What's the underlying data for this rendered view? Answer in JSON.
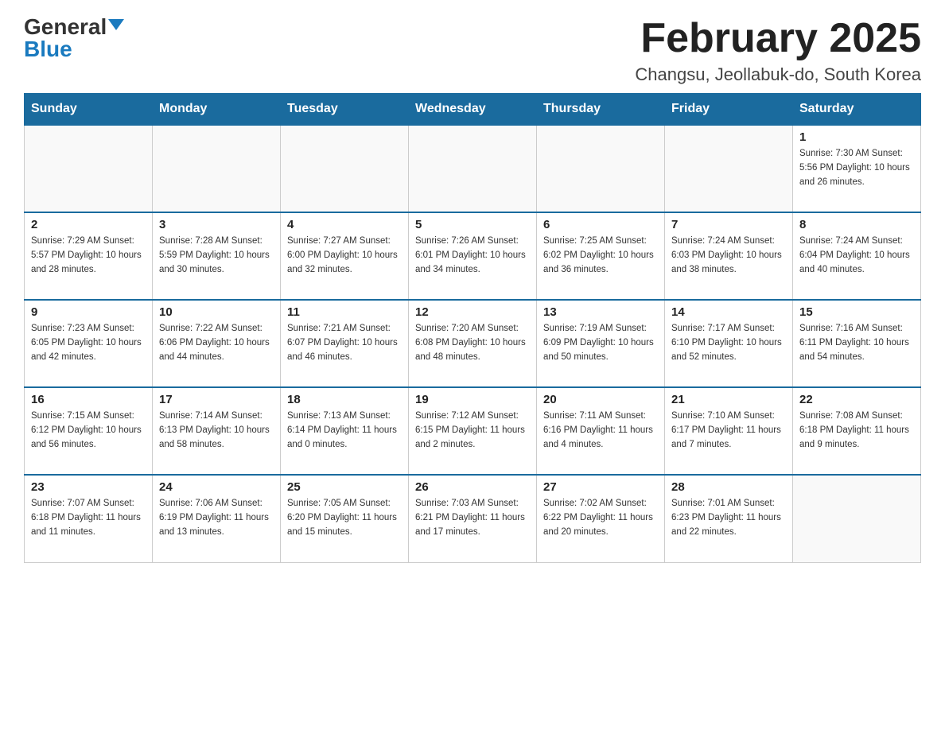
{
  "header": {
    "logo_general": "General",
    "logo_blue": "Blue",
    "month_title": "February 2025",
    "location": "Changsu, Jeollabuk-do, South Korea"
  },
  "days_of_week": [
    "Sunday",
    "Monday",
    "Tuesday",
    "Wednesday",
    "Thursday",
    "Friday",
    "Saturday"
  ],
  "weeks": [
    [
      {
        "day": "",
        "info": ""
      },
      {
        "day": "",
        "info": ""
      },
      {
        "day": "",
        "info": ""
      },
      {
        "day": "",
        "info": ""
      },
      {
        "day": "",
        "info": ""
      },
      {
        "day": "",
        "info": ""
      },
      {
        "day": "1",
        "info": "Sunrise: 7:30 AM\nSunset: 5:56 PM\nDaylight: 10 hours\nand 26 minutes."
      }
    ],
    [
      {
        "day": "2",
        "info": "Sunrise: 7:29 AM\nSunset: 5:57 PM\nDaylight: 10 hours\nand 28 minutes."
      },
      {
        "day": "3",
        "info": "Sunrise: 7:28 AM\nSunset: 5:59 PM\nDaylight: 10 hours\nand 30 minutes."
      },
      {
        "day": "4",
        "info": "Sunrise: 7:27 AM\nSunset: 6:00 PM\nDaylight: 10 hours\nand 32 minutes."
      },
      {
        "day": "5",
        "info": "Sunrise: 7:26 AM\nSunset: 6:01 PM\nDaylight: 10 hours\nand 34 minutes."
      },
      {
        "day": "6",
        "info": "Sunrise: 7:25 AM\nSunset: 6:02 PM\nDaylight: 10 hours\nand 36 minutes."
      },
      {
        "day": "7",
        "info": "Sunrise: 7:24 AM\nSunset: 6:03 PM\nDaylight: 10 hours\nand 38 minutes."
      },
      {
        "day": "8",
        "info": "Sunrise: 7:24 AM\nSunset: 6:04 PM\nDaylight: 10 hours\nand 40 minutes."
      }
    ],
    [
      {
        "day": "9",
        "info": "Sunrise: 7:23 AM\nSunset: 6:05 PM\nDaylight: 10 hours\nand 42 minutes."
      },
      {
        "day": "10",
        "info": "Sunrise: 7:22 AM\nSunset: 6:06 PM\nDaylight: 10 hours\nand 44 minutes."
      },
      {
        "day": "11",
        "info": "Sunrise: 7:21 AM\nSunset: 6:07 PM\nDaylight: 10 hours\nand 46 minutes."
      },
      {
        "day": "12",
        "info": "Sunrise: 7:20 AM\nSunset: 6:08 PM\nDaylight: 10 hours\nand 48 minutes."
      },
      {
        "day": "13",
        "info": "Sunrise: 7:19 AM\nSunset: 6:09 PM\nDaylight: 10 hours\nand 50 minutes."
      },
      {
        "day": "14",
        "info": "Sunrise: 7:17 AM\nSunset: 6:10 PM\nDaylight: 10 hours\nand 52 minutes."
      },
      {
        "day": "15",
        "info": "Sunrise: 7:16 AM\nSunset: 6:11 PM\nDaylight: 10 hours\nand 54 minutes."
      }
    ],
    [
      {
        "day": "16",
        "info": "Sunrise: 7:15 AM\nSunset: 6:12 PM\nDaylight: 10 hours\nand 56 minutes."
      },
      {
        "day": "17",
        "info": "Sunrise: 7:14 AM\nSunset: 6:13 PM\nDaylight: 10 hours\nand 58 minutes."
      },
      {
        "day": "18",
        "info": "Sunrise: 7:13 AM\nSunset: 6:14 PM\nDaylight: 11 hours\nand 0 minutes."
      },
      {
        "day": "19",
        "info": "Sunrise: 7:12 AM\nSunset: 6:15 PM\nDaylight: 11 hours\nand 2 minutes."
      },
      {
        "day": "20",
        "info": "Sunrise: 7:11 AM\nSunset: 6:16 PM\nDaylight: 11 hours\nand 4 minutes."
      },
      {
        "day": "21",
        "info": "Sunrise: 7:10 AM\nSunset: 6:17 PM\nDaylight: 11 hours\nand 7 minutes."
      },
      {
        "day": "22",
        "info": "Sunrise: 7:08 AM\nSunset: 6:18 PM\nDaylight: 11 hours\nand 9 minutes."
      }
    ],
    [
      {
        "day": "23",
        "info": "Sunrise: 7:07 AM\nSunset: 6:18 PM\nDaylight: 11 hours\nand 11 minutes."
      },
      {
        "day": "24",
        "info": "Sunrise: 7:06 AM\nSunset: 6:19 PM\nDaylight: 11 hours\nand 13 minutes."
      },
      {
        "day": "25",
        "info": "Sunrise: 7:05 AM\nSunset: 6:20 PM\nDaylight: 11 hours\nand 15 minutes."
      },
      {
        "day": "26",
        "info": "Sunrise: 7:03 AM\nSunset: 6:21 PM\nDaylight: 11 hours\nand 17 minutes."
      },
      {
        "day": "27",
        "info": "Sunrise: 7:02 AM\nSunset: 6:22 PM\nDaylight: 11 hours\nand 20 minutes."
      },
      {
        "day": "28",
        "info": "Sunrise: 7:01 AM\nSunset: 6:23 PM\nDaylight: 11 hours\nand 22 minutes."
      },
      {
        "day": "",
        "info": ""
      }
    ]
  ]
}
